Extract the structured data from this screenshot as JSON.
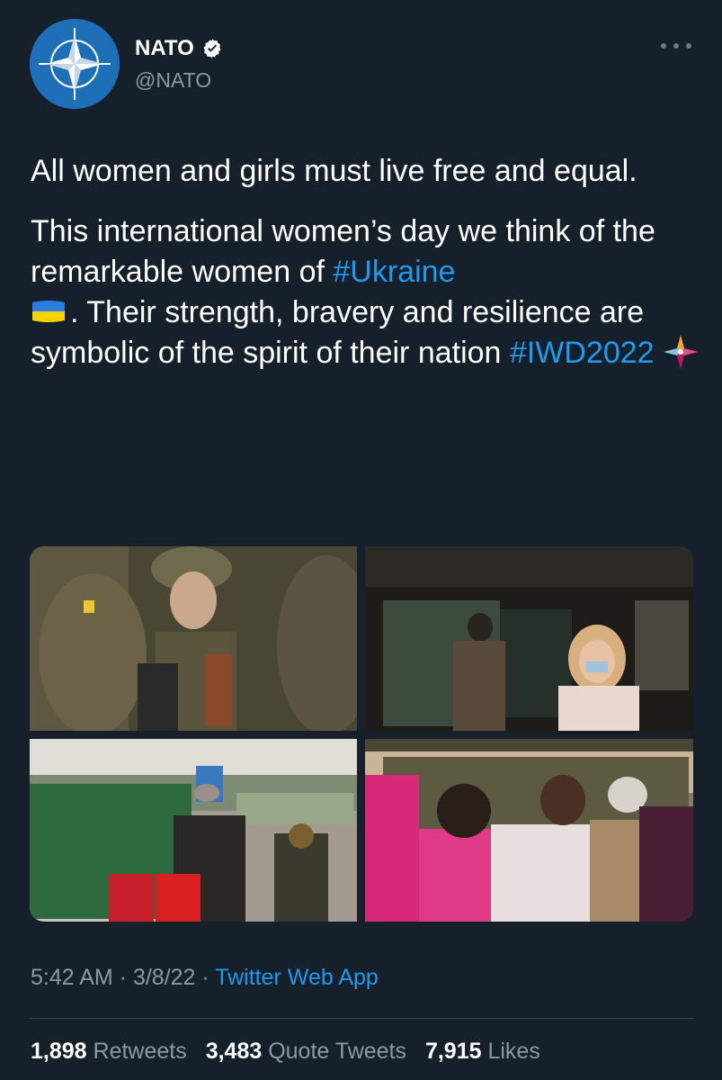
{
  "colors": {
    "background": "#15202b",
    "link": "#1d9bf0",
    "muted": "#8b98a5",
    "divider": "#38444d"
  },
  "account": {
    "name": "NATO",
    "handle": "@NATO",
    "avatar_icon": "nato-compass-star-icon",
    "verified_icon": "verified-badge-icon",
    "more_icon": "more-options-icon"
  },
  "tweet": {
    "paragraph1": "All women and girls must live free and equal.",
    "p2_text1": "This international women’s day we think of the remarkable women of ",
    "p2_hashtag1": "#Ukraine",
    "flag_icon": "ukraine-flag-emoji",
    "p2_text2": ". Their strength, bravery and resilience are symbolic of the spirit of their nation ",
    "p2_hashtag2": "#IWD2022",
    "sparkle_icon": "iwd-sparkle-emoji"
  },
  "media": {
    "photos": [
      {
        "subject": "female-soldier-photo"
      },
      {
        "subject": "woman-in-mask-corridor-photo"
      },
      {
        "subject": "refugees-walking-photo"
      },
      {
        "subject": "women-weaving-camouflage-net-photo"
      }
    ]
  },
  "meta": {
    "time": "5:42 AM",
    "sep1": " · ",
    "date": "3/8/22",
    "sep2": " · ",
    "app": "Twitter Web App"
  },
  "stats": {
    "retweets_count": "1,898",
    "retweets_label": "Retweets",
    "quotes_count": "3,483",
    "quotes_label": "Quote Tweets",
    "likes_count": "7,915",
    "likes_label": "Likes"
  }
}
